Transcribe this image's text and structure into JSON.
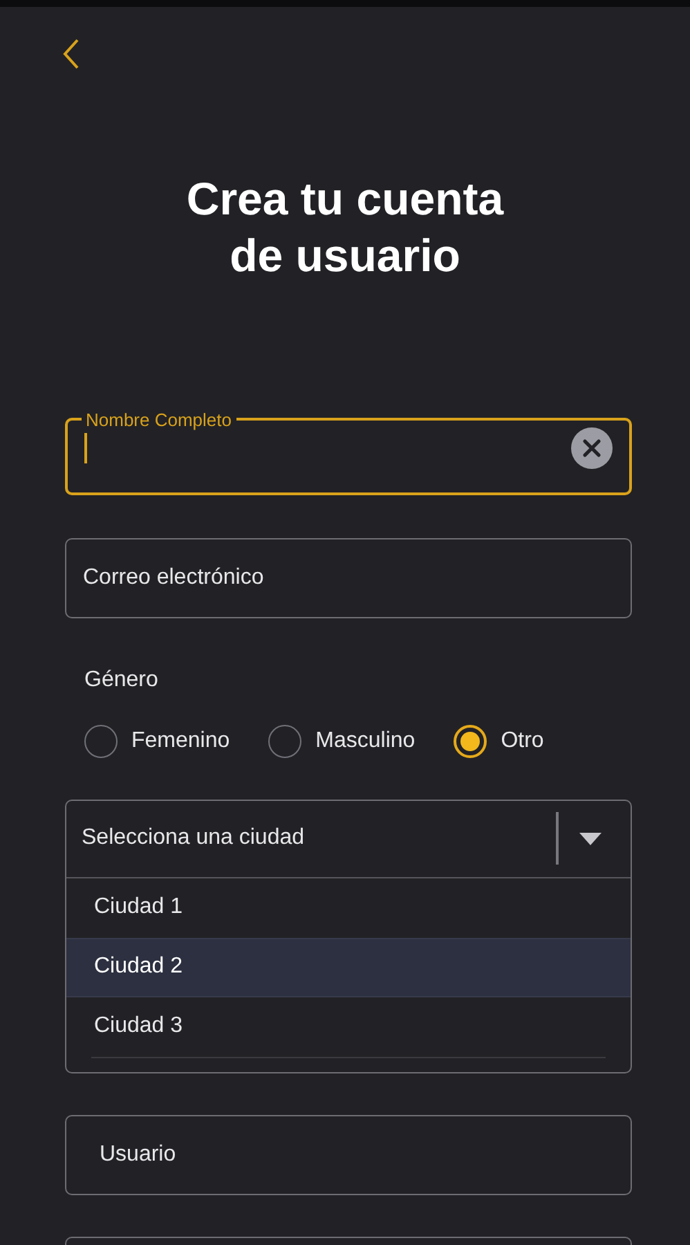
{
  "title": "Crea tu cuenta de usuario",
  "name_field": {
    "label": "Nombre Completo",
    "focused": true
  },
  "email_field": {
    "placeholder": "Correo electrónico",
    "focused": false
  },
  "gender": {
    "label": "Género",
    "options": [
      {
        "label": "Femenino",
        "selected": false
      },
      {
        "label": "Masculino",
        "selected": false
      },
      {
        "label": "Otro",
        "selected": true
      }
    ]
  },
  "city_select": {
    "placeholder": "Selecciona una ciudad",
    "expanded": true,
    "options": [
      {
        "label": "Ciudad 1",
        "selected": false
      },
      {
        "label": "Ciudad 2",
        "selected": true
      },
      {
        "label": "Ciudad 3",
        "selected": false
      }
    ]
  },
  "user_field": {
    "placeholder": "Usuario",
    "focused": false
  }
}
